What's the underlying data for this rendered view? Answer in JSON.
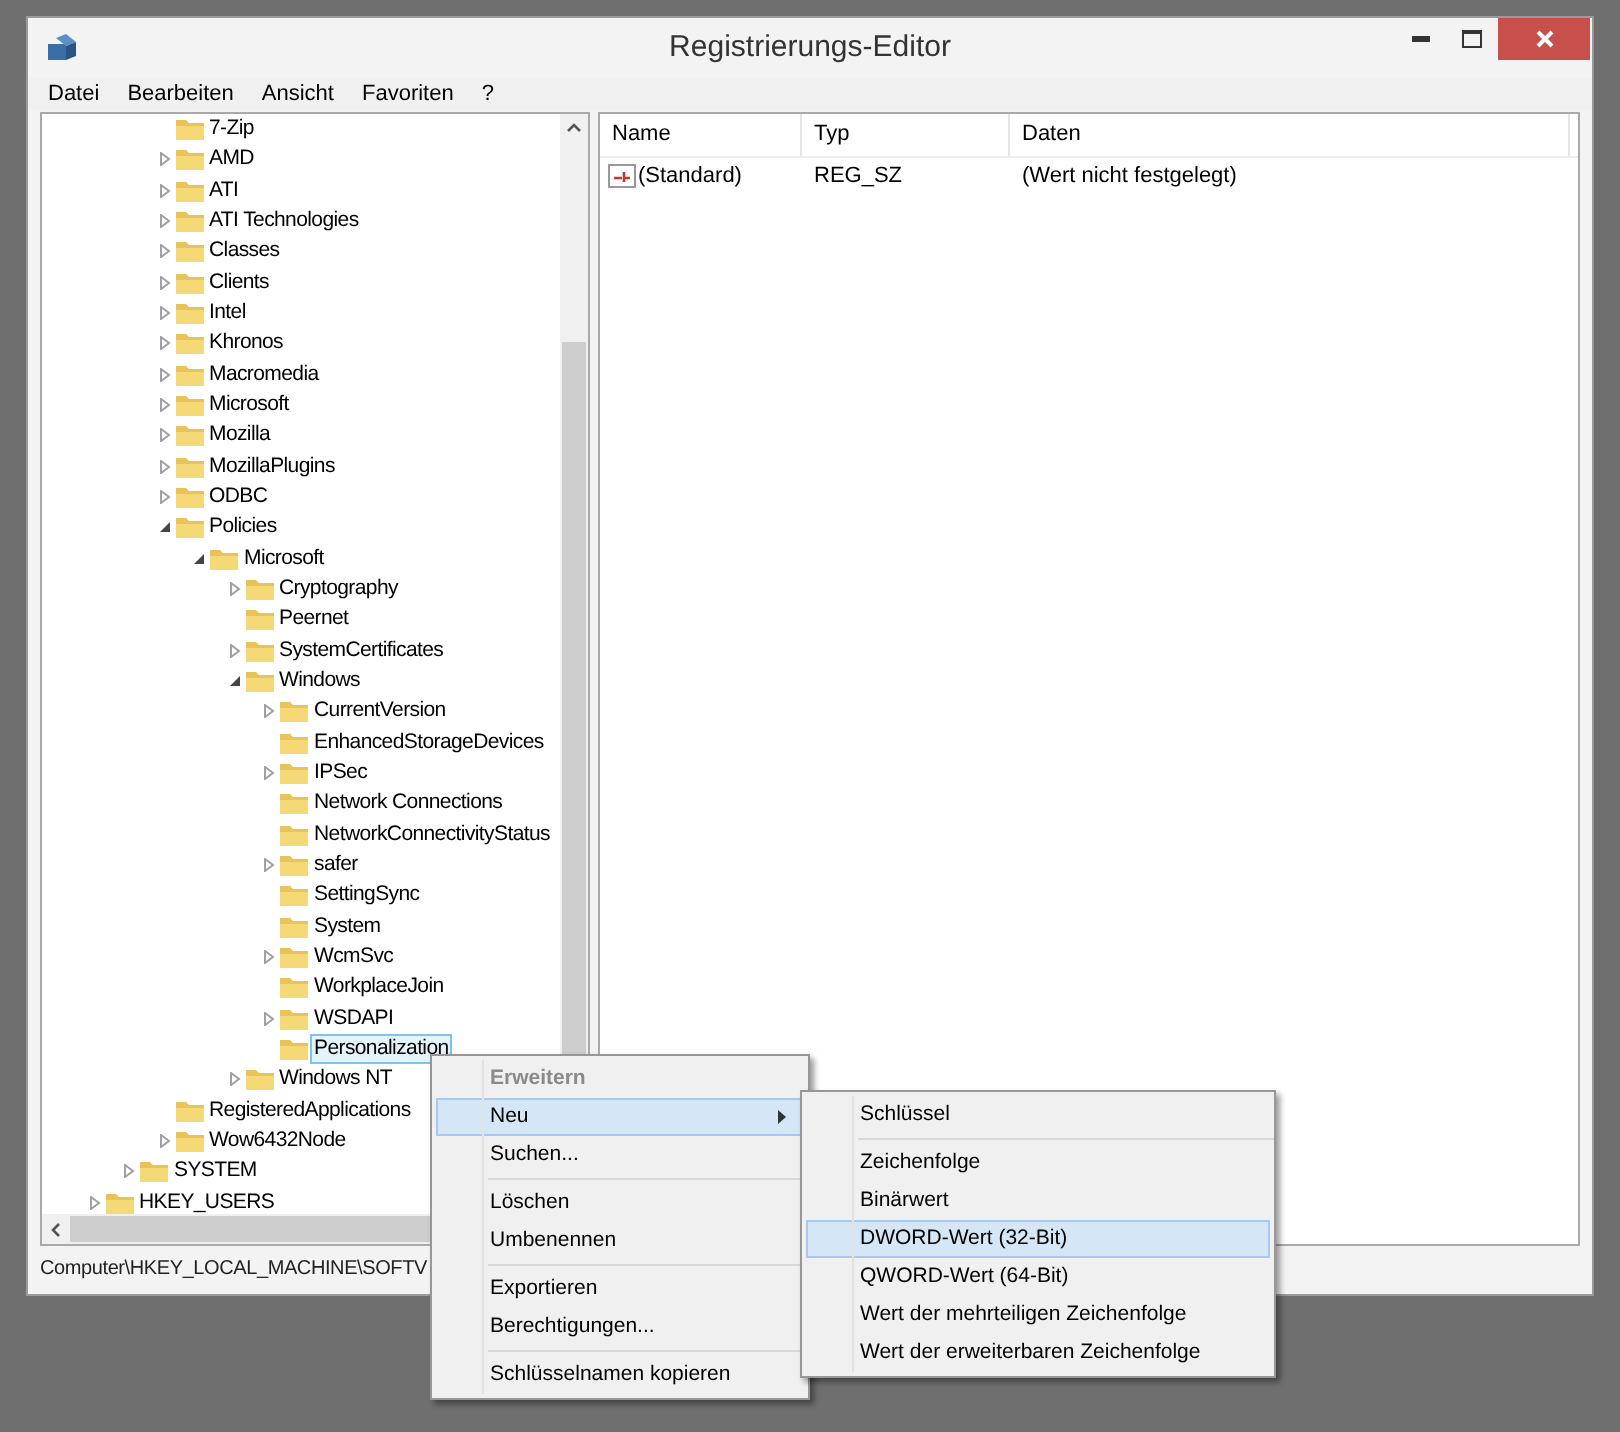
{
  "window": {
    "title": "Registrierungs-Editor"
  },
  "menu_bar": [
    "Datei",
    "Bearbeiten",
    "Ansicht",
    "Favoriten",
    "?"
  ],
  "tree": {
    "items": [
      {
        "children": [
          {
            "children": [
              {
                "children": [
                  {
                    "label": "7-Zip",
                    "kind": "leaf",
                    "selected": false
                  },
                  {
                    "label": "AMD",
                    "kind": "node",
                    "expanded": false,
                    "selected": false
                  },
                  {
                    "label": "ATI",
                    "kind": "node",
                    "expanded": false,
                    "selected": false
                  },
                  {
                    "label": "ATI Technologies",
                    "kind": "node",
                    "expanded": false,
                    "selected": false
                  },
                  {
                    "label": "Classes",
                    "kind": "node",
                    "expanded": false,
                    "selected": false
                  },
                  {
                    "label": "Clients",
                    "kind": "node",
                    "expanded": false,
                    "selected": false
                  },
                  {
                    "label": "Intel",
                    "kind": "node",
                    "expanded": false,
                    "selected": false
                  },
                  {
                    "label": "Khronos",
                    "kind": "node",
                    "expanded": false,
                    "selected": false
                  },
                  {
                    "label": "Macromedia",
                    "kind": "node",
                    "expanded": false,
                    "selected": false
                  },
                  {
                    "label": "Microsoft",
                    "kind": "node",
                    "expanded": false,
                    "selected": false
                  },
                  {
                    "label": "Mozilla",
                    "kind": "node",
                    "expanded": false,
                    "selected": false
                  },
                  {
                    "label": "MozillaPlugins",
                    "kind": "node",
                    "expanded": false,
                    "selected": false
                  },
                  {
                    "label": "ODBC",
                    "kind": "node",
                    "expanded": false,
                    "selected": false
                  },
                  {
                    "label": "Policies",
                    "kind": "node",
                    "expanded": true,
                    "selected": false,
                    "children": [
                      {
                        "label": "Microsoft",
                        "kind": "node",
                        "expanded": true,
                        "selected": false,
                        "children": [
                          {
                            "label": "Cryptography",
                            "kind": "node",
                            "expanded": false,
                            "selected": false
                          },
                          {
                            "label": "Peernet",
                            "kind": "leaf",
                            "selected": false
                          },
                          {
                            "label": "SystemCertificates",
                            "kind": "node",
                            "expanded": false,
                            "selected": false
                          },
                          {
                            "label": "Windows",
                            "kind": "node",
                            "expanded": true,
                            "selected": false,
                            "children": [
                              {
                                "label": "CurrentVersion",
                                "kind": "node",
                                "expanded": false,
                                "selected": false
                              },
                              {
                                "label": "EnhancedStorageDevices",
                                "kind": "leaf",
                                "selected": false
                              },
                              {
                                "label": "IPSec",
                                "kind": "node",
                                "expanded": false,
                                "selected": false
                              },
                              {
                                "label": "Network Connections",
                                "kind": "leaf",
                                "selected": false
                              },
                              {
                                "label": "NetworkConnectivityStatus",
                                "kind": "leaf",
                                "selected": false
                              },
                              {
                                "label": "safer",
                                "kind": "node",
                                "expanded": false,
                                "selected": false
                              },
                              {
                                "label": "SettingSync",
                                "kind": "leaf",
                                "selected": false
                              },
                              {
                                "label": "System",
                                "kind": "leaf",
                                "selected": false
                              },
                              {
                                "label": "WcmSvc",
                                "kind": "node",
                                "expanded": false,
                                "selected": false
                              },
                              {
                                "label": "WorkplaceJoin",
                                "kind": "leaf",
                                "selected": false
                              },
                              {
                                "label": "WSDAPI",
                                "kind": "node",
                                "expanded": false,
                                "selected": false
                              },
                              {
                                "label": "Personalization",
                                "kind": "leaf",
                                "selected": true
                              }
                            ]
                          },
                          {
                            "label": "Windows NT",
                            "kind": "node",
                            "expanded": false,
                            "selected": false
                          }
                        ]
                      }
                    ]
                  },
                  {
                    "label": "RegisteredApplications",
                    "kind": "leaf",
                    "selected": false
                  },
                  {
                    "label": "Wow6432Node",
                    "kind": "node",
                    "expanded": false,
                    "selected": false
                  }
                ]
              },
              {
                "label": "SYSTEM",
                "kind": "node",
                "expanded": false,
                "selected": false
              }
            ]
          },
          {
            "label": "HKEY_USERS",
            "kind": "node",
            "expanded": false,
            "selected": false
          }
        ]
      }
    ]
  },
  "table": {
    "columns": [
      "Name",
      "Typ",
      "Daten"
    ],
    "rows": [
      {
        "name": "(Standard)",
        "type": "REG_SZ",
        "data": "(Wert nicht festgelegt)"
      }
    ]
  },
  "status_bar": "Computer\\HKEY_LOCAL_MACHINE\\SOFTV",
  "context_menu": {
    "items": [
      {
        "kind": "item",
        "label": "Erweitern",
        "disabled": true,
        "selected": false,
        "submenu": false
      },
      {
        "kind": "item",
        "label": "Neu",
        "disabled": false,
        "selected": true,
        "submenu": true
      },
      {
        "kind": "item",
        "label": "Suchen...",
        "disabled": false,
        "selected": false,
        "submenu": false
      },
      {
        "kind": "separator"
      },
      {
        "kind": "item",
        "label": "Löschen",
        "disabled": false,
        "selected": false,
        "submenu": false
      },
      {
        "kind": "item",
        "label": "Umbenennen",
        "disabled": false,
        "selected": false,
        "submenu": false
      },
      {
        "kind": "separator"
      },
      {
        "kind": "item",
        "label": "Exportieren",
        "disabled": false,
        "selected": false,
        "submenu": false
      },
      {
        "kind": "item",
        "label": "Berechtigungen...",
        "disabled": false,
        "selected": false,
        "submenu": false
      },
      {
        "kind": "separator"
      },
      {
        "kind": "item",
        "label": "Schlüsselnamen kopieren",
        "disabled": false,
        "selected": false,
        "submenu": false
      }
    ]
  },
  "submenu": {
    "items": [
      {
        "kind": "item",
        "label": "Schlüssel",
        "disabled": false,
        "selected": false,
        "submenu": false
      },
      {
        "kind": "separator"
      },
      {
        "kind": "item",
        "label": "Zeichenfolge",
        "disabled": false,
        "selected": false,
        "submenu": false
      },
      {
        "kind": "item",
        "label": "Binärwert",
        "disabled": false,
        "selected": false,
        "submenu": false
      },
      {
        "kind": "item",
        "label": "DWORD-Wert (32-Bit)",
        "disabled": false,
        "selected": true,
        "submenu": false
      },
      {
        "kind": "item",
        "label": "QWORD-Wert (64-Bit)",
        "disabled": false,
        "selected": false,
        "submenu": false
      },
      {
        "kind": "item",
        "label": "Wert der mehrteiligen Zeichenfolge",
        "disabled": false,
        "selected": false,
        "submenu": false
      },
      {
        "kind": "item",
        "label": "Wert der erweiterbaren Zeichenfolge",
        "disabled": false,
        "selected": false,
        "submenu": false
      }
    ]
  }
}
